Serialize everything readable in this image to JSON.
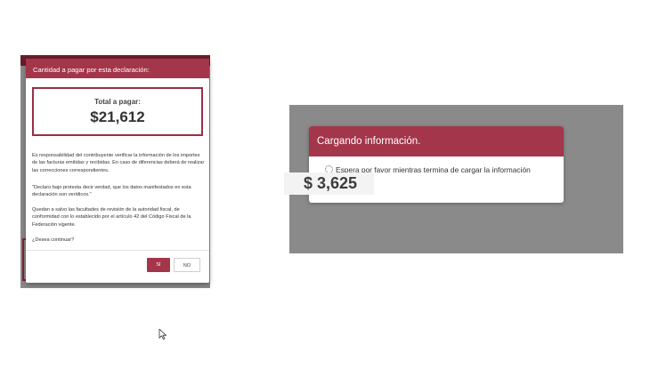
{
  "dialog": {
    "title": "Cantidad a pagar por esta declaración:",
    "total_label": "Total a pagar:",
    "total_value": "$21,612",
    "paragraphs": [
      "Es responsabilidad del contribuyente verificar la información de los importes de las facturas emitidas y recibidas. En caso de diferencias deberá de realizar las correcciones correspondientes.",
      "\"Declaro bajo protesta decir verdad, que los datos manifestados en esta declaración son verídicos.\"",
      "Quedan a salvo las facultades de revisión de la autoridad fiscal, de conformidad con lo establecido por el artículo 42 del Código Fiscal de la Federación vigente.",
      "¿Desea continuar?"
    ],
    "btn_yes": "SÍ",
    "btn_no": "NO"
  },
  "loading": {
    "title": "Cargando información.",
    "message": "Espera por favor mientras termina de cargar la información",
    "amount": "$ 3,625"
  },
  "colors": {
    "brand": "#a3364a",
    "overlay": "#8a8a8a"
  }
}
